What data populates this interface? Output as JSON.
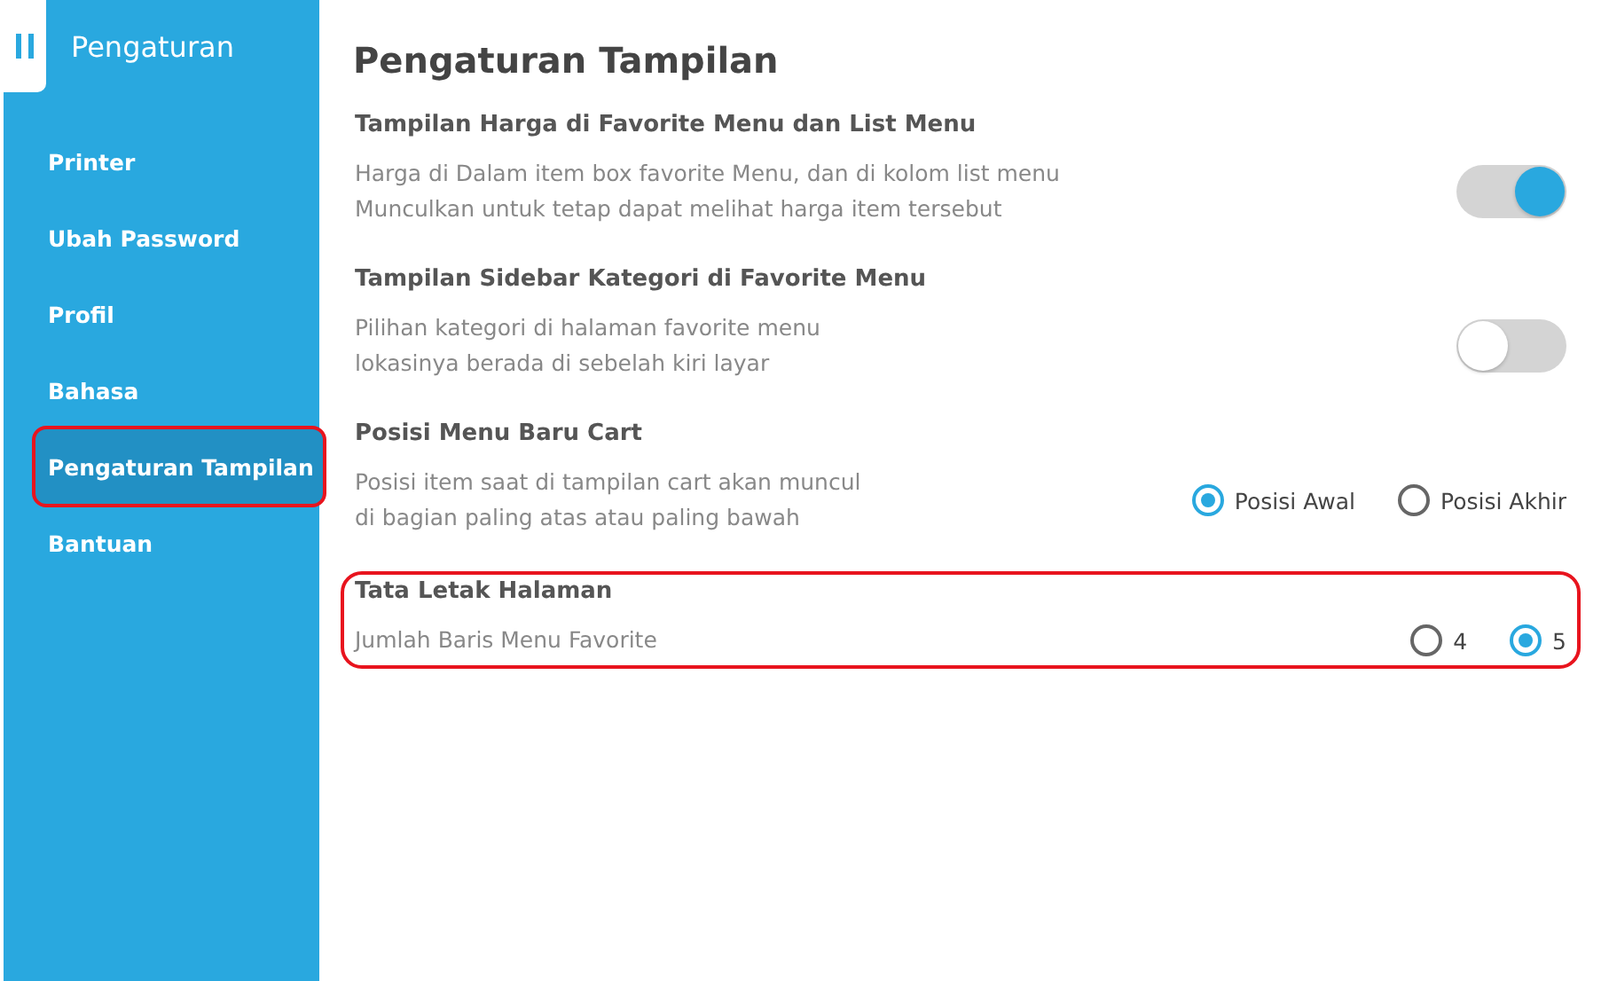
{
  "sidebar": {
    "title": "Pengaturan",
    "items": [
      {
        "label": "Printer",
        "selected": false,
        "highlighted": false
      },
      {
        "label": "Ubah Password",
        "selected": false,
        "highlighted": false
      },
      {
        "label": "Profil",
        "selected": false,
        "highlighted": false
      },
      {
        "label": "Bahasa",
        "selected": false,
        "highlighted": false
      },
      {
        "label": "Pengaturan Tampilan",
        "selected": true,
        "highlighted": true
      },
      {
        "label": "Bantuan",
        "selected": false,
        "highlighted": false
      }
    ]
  },
  "page": {
    "title": "Pengaturan Tampilan"
  },
  "sections": [
    {
      "kind": "toggle",
      "title": "Tampilan Harga di Favorite Menu dan List Menu",
      "description": [
        "Harga di Dalam item box favorite Menu, dan di kolom list menu",
        "Munculkan untuk tetap dapat melihat harga item tersebut"
      ],
      "on": true,
      "highlighted": false
    },
    {
      "kind": "toggle",
      "title": "Tampilan Sidebar Kategori di Favorite Menu",
      "description": [
        "Pilihan kategori di halaman favorite menu",
        "lokasinya berada di sebelah kiri layar"
      ],
      "on": false,
      "highlighted": false
    },
    {
      "kind": "radio",
      "title": "Posisi Menu Baru Cart",
      "description": [
        "Posisi item saat di tampilan cart akan muncul",
        "di bagian paling atas atau paling bawah"
      ],
      "options": [
        {
          "label": "Posisi Awal",
          "selected": true
        },
        {
          "label": "Posisi Akhir",
          "selected": false
        }
      ],
      "highlighted": false
    },
    {
      "kind": "radio",
      "title": "Tata Letak Halaman",
      "description": [
        "Jumlah Baris Menu Favorite"
      ],
      "options": [
        {
          "label": "4",
          "selected": false
        },
        {
          "label": "5",
          "selected": true
        }
      ],
      "highlighted": true
    }
  ]
}
